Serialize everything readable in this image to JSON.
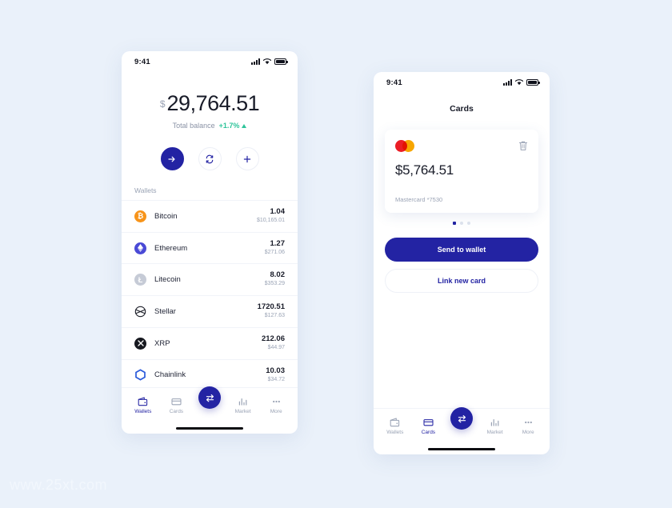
{
  "background_color": "#eaf1fa",
  "accent_color": "#2323a3",
  "positive_color": "#2ec49a",
  "watermark": "www.25xt.com",
  "phone_wallets": {
    "name": "wallets-screen",
    "status_bar": {
      "time": "9:41",
      "icons": [
        "signal-icon",
        "wifi-icon",
        "battery-icon"
      ]
    },
    "balance": {
      "currency_symbol": "$",
      "amount": "29,764.51",
      "label": "Total balance",
      "change": "+1.7%",
      "change_direction": "up"
    },
    "actions": [
      {
        "name": "send-button",
        "icon": "arrow-right-icon",
        "style": "primary"
      },
      {
        "name": "exchange-button",
        "icon": "refresh-icon",
        "style": "outline"
      },
      {
        "name": "add-button",
        "icon": "plus-icon",
        "style": "outline"
      }
    ],
    "section_label": "Wallets",
    "wallets": [
      {
        "name": "Bitcoin",
        "icon": "bitcoin-icon",
        "qty": "1.04",
        "usd": "$10,165.01"
      },
      {
        "name": "Ethereum",
        "icon": "ethereum-icon",
        "qty": "1.27",
        "usd": "$271.06"
      },
      {
        "name": "Litecoin",
        "icon": "litecoin-icon",
        "qty": "8.02",
        "usd": "$353.29"
      },
      {
        "name": "Stellar",
        "icon": "stellar-icon",
        "qty": "1720.51",
        "usd": "$127.63"
      },
      {
        "name": "XRP",
        "icon": "xrp-icon",
        "qty": "212.06",
        "usd": "$44.97"
      },
      {
        "name": "Chainlink",
        "icon": "chainlink-icon",
        "qty": "10.03",
        "usd": "$34.72"
      }
    ],
    "tabs": [
      {
        "label": "Wallets",
        "icon": "wallet-icon",
        "active": true
      },
      {
        "label": "Cards",
        "icon": "card-icon",
        "active": false
      },
      {
        "label": "Market",
        "icon": "chart-icon",
        "active": false
      },
      {
        "label": "More",
        "icon": "dots-icon",
        "active": false
      }
    ],
    "fab": {
      "name": "exchange-fab",
      "icon": "exchange-arrows-icon"
    }
  },
  "phone_cards": {
    "name": "cards-screen",
    "status_bar": {
      "time": "9:41",
      "icons": [
        "signal-icon",
        "wifi-icon",
        "battery-icon"
      ]
    },
    "title": "Cards",
    "card": {
      "brand_icon": "mastercard-icon",
      "delete_icon": "trash-icon",
      "amount": "$5,764.51",
      "label": "Mastercard *7530"
    },
    "pagination": {
      "count": 3,
      "active_index": 0
    },
    "buttons": [
      {
        "label": "Send to wallet",
        "style": "filled"
      },
      {
        "label": "Link new card",
        "style": "outline"
      }
    ],
    "tabs": [
      {
        "label": "Wallets",
        "icon": "wallet-icon",
        "active": false
      },
      {
        "label": "Cards",
        "icon": "card-icon",
        "active": true
      },
      {
        "label": "Market",
        "icon": "chart-icon",
        "active": false
      },
      {
        "label": "More",
        "icon": "dots-icon",
        "active": false
      }
    ],
    "fab": {
      "name": "exchange-fab",
      "icon": "exchange-arrows-icon"
    }
  }
}
